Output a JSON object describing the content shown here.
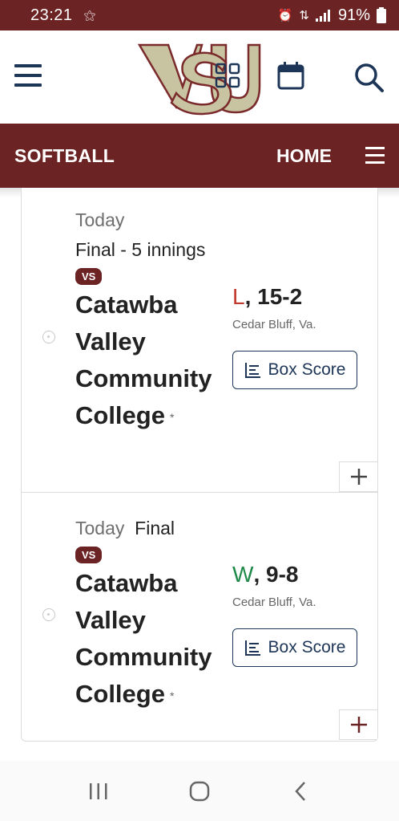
{
  "status_bar": {
    "time": "23:21",
    "battery": "91%"
  },
  "header": {
    "menu_icon": "hamburger-icon",
    "logo_text": "VSU",
    "apps_icon": "apps-grid-icon",
    "calendar_icon": "calendar-icon",
    "search_icon": "search-icon"
  },
  "sport_nav": {
    "title": "SOFTBALL",
    "home_label": "HOME",
    "menu_icon": "menu-icon"
  },
  "games": [
    {
      "date": "Today",
      "status": "Final - 5 innings",
      "vs_label": "VS",
      "opponent": "Catawba Valley Community College",
      "asterisk": "*",
      "result_letter": "L",
      "score": ", 15-2",
      "location": "Cedar Bluff, Va.",
      "box_score_label": "Box Score",
      "result_color": "#c0392b"
    },
    {
      "date": "Today",
      "status": "Final",
      "vs_label": "VS",
      "opponent": "Catawba Valley Community College",
      "asterisk": "*",
      "result_letter": "W",
      "score": ", 9-8",
      "location": "Cedar Bluff, Va.",
      "box_score_label": "Box Score",
      "result_color": "#1e8a4a"
    }
  ],
  "colors": {
    "brand_maroon": "#6b2324",
    "navy": "#1d3557"
  },
  "system_nav": {
    "recents_icon": "recents-icon",
    "home_icon": "home-circle-icon",
    "back_icon": "back-chevron-icon"
  }
}
